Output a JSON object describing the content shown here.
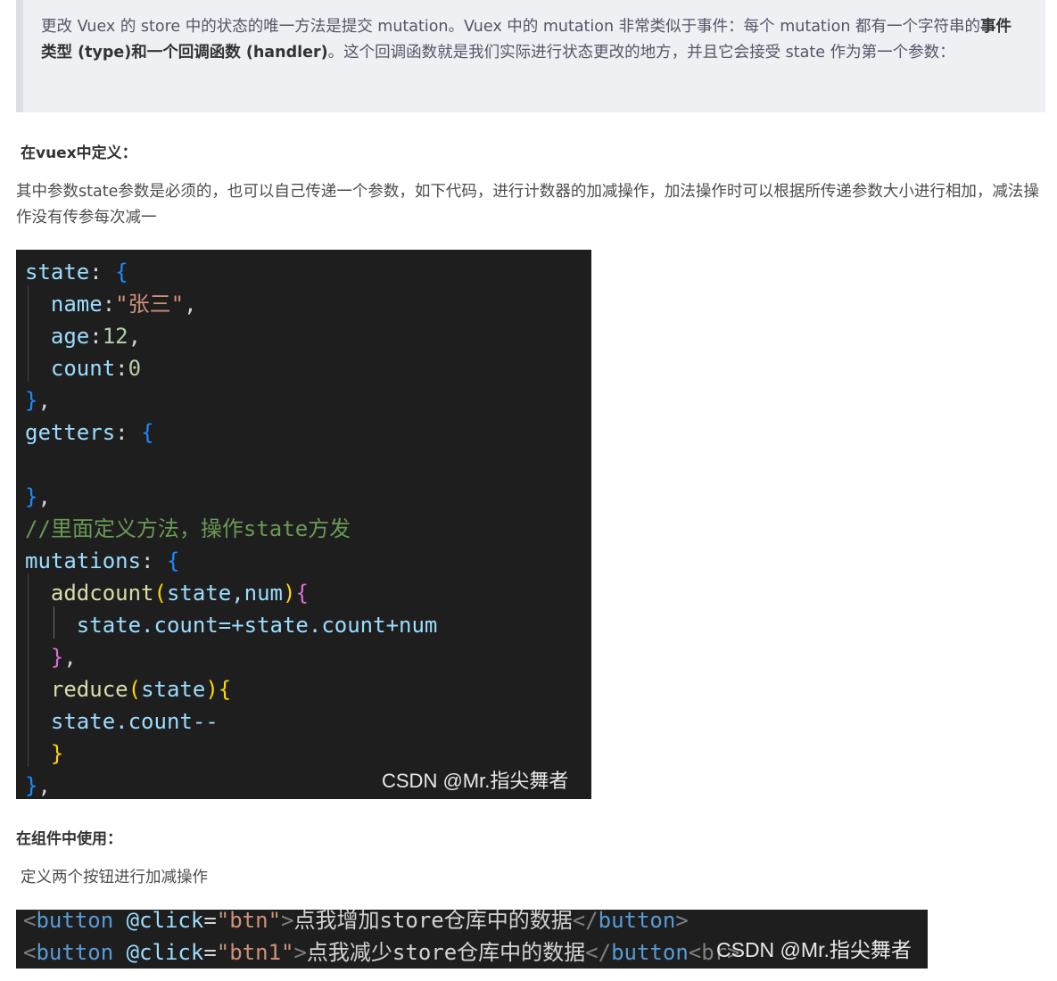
{
  "quote": {
    "part1": "更改 Vuex 的 store 中的状态的唯一方法是提交 mutation。Vuex 中的 mutation 非常类似于事件：每个 mutation 都有一个字符串的",
    "bold": "事件类型 (type)和一个回调函数 (handler)",
    "part2": "。这个回调函数就是我们实际进行状态更改的地方，并且它会接受 state 作为第一个参数："
  },
  "heading1": "在vuex中定义：",
  "para1": "其中参数state参数是必须的，也可以自己传递一个参数，如下代码，进行计数器的加减操作，加法操作时可以根据所传递参数大小进行相加，减法操作没有传参每次减一",
  "code1": {
    "state": "state",
    "name_key": "name",
    "name_val": "\"张三\"",
    "age_key": "age",
    "age_val": "12",
    "count_key": "count",
    "count_val": "0",
    "getters": "getters",
    "comment": "//里面定义方法，操作state方发",
    "mutations": "mutations",
    "addcount": "addcount",
    "add_args": "state,num",
    "add_body": "state.count=+state.count+num",
    "reduce": "reduce",
    "reduce_args": "state",
    "reduce_body": "state.count--",
    "watermark": "CSDN @Mr.指尖舞者"
  },
  "heading2": "在组件中使用：",
  "para2": "定义两个按钮进行加减操作",
  "code2": {
    "tag": "button",
    "attr": "@click",
    "val1": "\"btn\"",
    "text1": "点我增加store仓库中的数据",
    "val2": "\"btn1\"",
    "text2": "点我减少store仓库中的数据",
    "trail": "<br>",
    "watermark": "CSDN @Mr.指尖舞者"
  }
}
